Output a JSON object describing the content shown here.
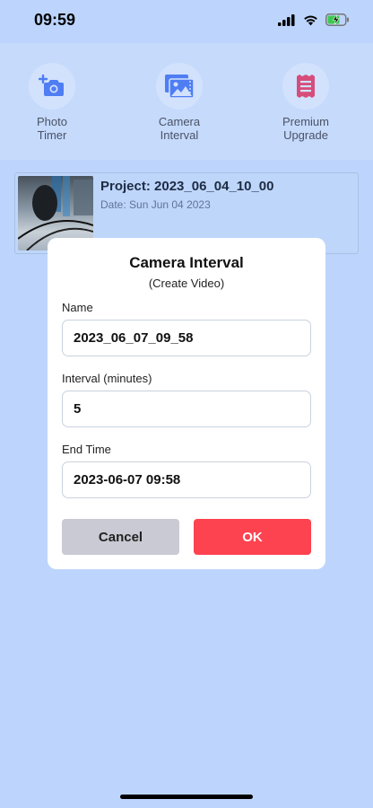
{
  "status_bar": {
    "time": "09:59"
  },
  "toolbar": {
    "items": [
      {
        "label": "Photo\nTimer",
        "icon": "camera-plus-icon"
      },
      {
        "label": "Camera\nInterval",
        "icon": "photo-gallery-icon"
      },
      {
        "label": "Premium\nUpgrade",
        "icon": "receipt-icon"
      }
    ]
  },
  "project": {
    "title": "Project: 2023_06_04_10_00",
    "date": "Date: Sun Jun 04 2023"
  },
  "dialog": {
    "title": "Camera Interval",
    "subtitle": "(Create Video)",
    "name_label": "Name",
    "name_value": "2023_06_07_09_58",
    "interval_label": "Interval (minutes)",
    "interval_value": "5",
    "end_time_label": "End Time",
    "end_time_value": "2023-06-07 09:58",
    "cancel_label": "Cancel",
    "ok_label": "OK"
  },
  "colors": {
    "background": "#bdd5fc",
    "accent_blue": "#4f7df3",
    "accent_pink": "#d64d7b",
    "ok_button": "#fd4250",
    "cancel_button": "#c9cad3",
    "battery": "#3dc94f"
  }
}
